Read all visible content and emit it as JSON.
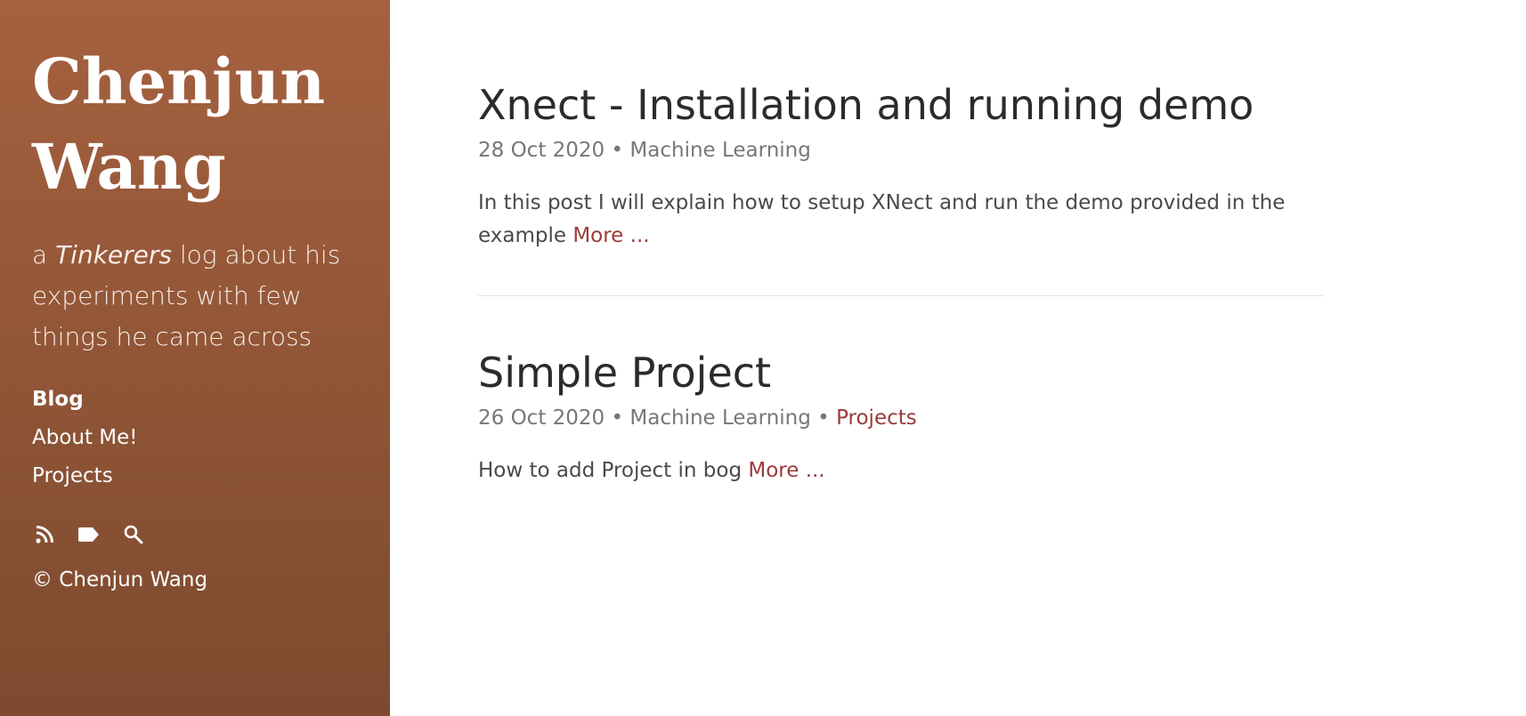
{
  "sidebar": {
    "title_line1": "Chenjun",
    "title_line2": "Wang",
    "tagline_prefix": "a ",
    "tagline_em": "Tinkerers",
    "tagline_suffix": " log about his experiments with few things he came across",
    "nav": [
      {
        "label": "Blog",
        "active": true
      },
      {
        "label": "About Me!",
        "active": false
      },
      {
        "label": "Projects",
        "active": false
      }
    ],
    "icons": [
      "rss-icon",
      "tag-icon",
      "search-icon"
    ],
    "copyright": "© Chenjun Wang"
  },
  "posts": [
    {
      "title": "Xnect - Installation and running demo",
      "date": "28 Oct 2020",
      "category": "Machine Learning",
      "tag": "",
      "excerpt": "In this post I will explain how to setup XNect and run the demo provided in the example ",
      "more": "More ..."
    },
    {
      "title": "Simple Project",
      "date": "26 Oct 2020",
      "category": "Machine Learning",
      "tag": "Projects",
      "excerpt": "How to add Project in bog ",
      "more": "More ..."
    }
  ],
  "colors": {
    "sidebar_top": "#a5613f",
    "sidebar_bottom": "#7d4a2f",
    "link": "#9c3a3a"
  }
}
